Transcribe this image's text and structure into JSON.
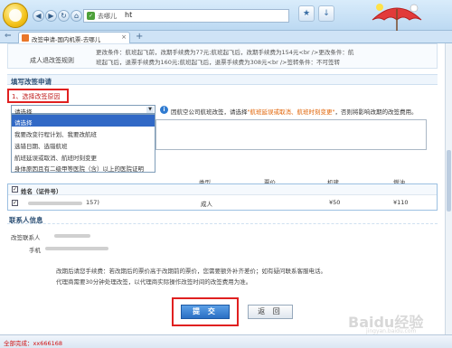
{
  "browser": {
    "site_name": "去哪儿",
    "url_fragment": "ht",
    "nav_buttons": [
      "◀",
      "▶",
      "↻",
      "⌂"
    ],
    "toolbar_icons": [
      "star-icon",
      "download-icon"
    ],
    "tab": {
      "title": "改签申请-国内机票-去哪儿",
      "close": "×",
      "new": "+"
    }
  },
  "rules": {
    "label": "成人退改签规则",
    "lines": [
      "更改条件：航班起飞前，改期手续费为77元;航班起飞后，改期手续费为154元<br />更改条件：航",
      "班起飞后，退票手续费为160元;航班起飞后，退票手续费为308元<br />签转条件：不可签转"
    ]
  },
  "form": {
    "section_title": "填写改签申请",
    "step_label": "1、选择改签原因",
    "dropdown": {
      "selected": "请选择",
      "arrow": "▼",
      "options": [
        "请选择",
        "我要改变行程计划、我要改航班",
        "选错日期、选错航班",
        "航班延误或取消、航班时刻变更",
        "身体原因且有二级甲等医院（含）以上的医院证明"
      ]
    },
    "info": {
      "icon": "i",
      "before": "因航空公司航班改签，请选择",
      "highlight": "\"航班延误或取消、航班时刻变更\"",
      "after": "，否则将影响改期的改签费用。"
    }
  },
  "passengers": {
    "headers": [
      "类型",
      "票价",
      "机建",
      "燃油"
    ],
    "header_row": {
      "check": "✓",
      "label": "姓名（证件号）"
    },
    "rows": [
      {
        "check": "✓",
        "name": "157)",
        "type": "成人",
        "price": "",
        "tax": "¥50",
        "fuel": "¥110"
      }
    ]
  },
  "contact": {
    "title": "联系人信息",
    "name_label": "改签联系人",
    "phone_label": "手机",
    "notice": [
      "改期后请您手续费：若改期后的票价高于改期前的票价，您需要额外补齐差价；如有疑问联系客服电话。",
      "代理商需要30分钟处理改签，以代理商实际操作改签时间的改签费用为准。"
    ]
  },
  "buttons": {
    "submit": "提 交",
    "back": "返 回"
  },
  "status": {
    "text": "全部完成：xx666168"
  },
  "watermark": {
    "main": "Baidu经验",
    "sub": "jingyan.baidu.com"
  },
  "colors": {
    "highlight_red": "#e02020",
    "link_orange": "#e06000",
    "accent_blue": "#2a6fc4"
  }
}
